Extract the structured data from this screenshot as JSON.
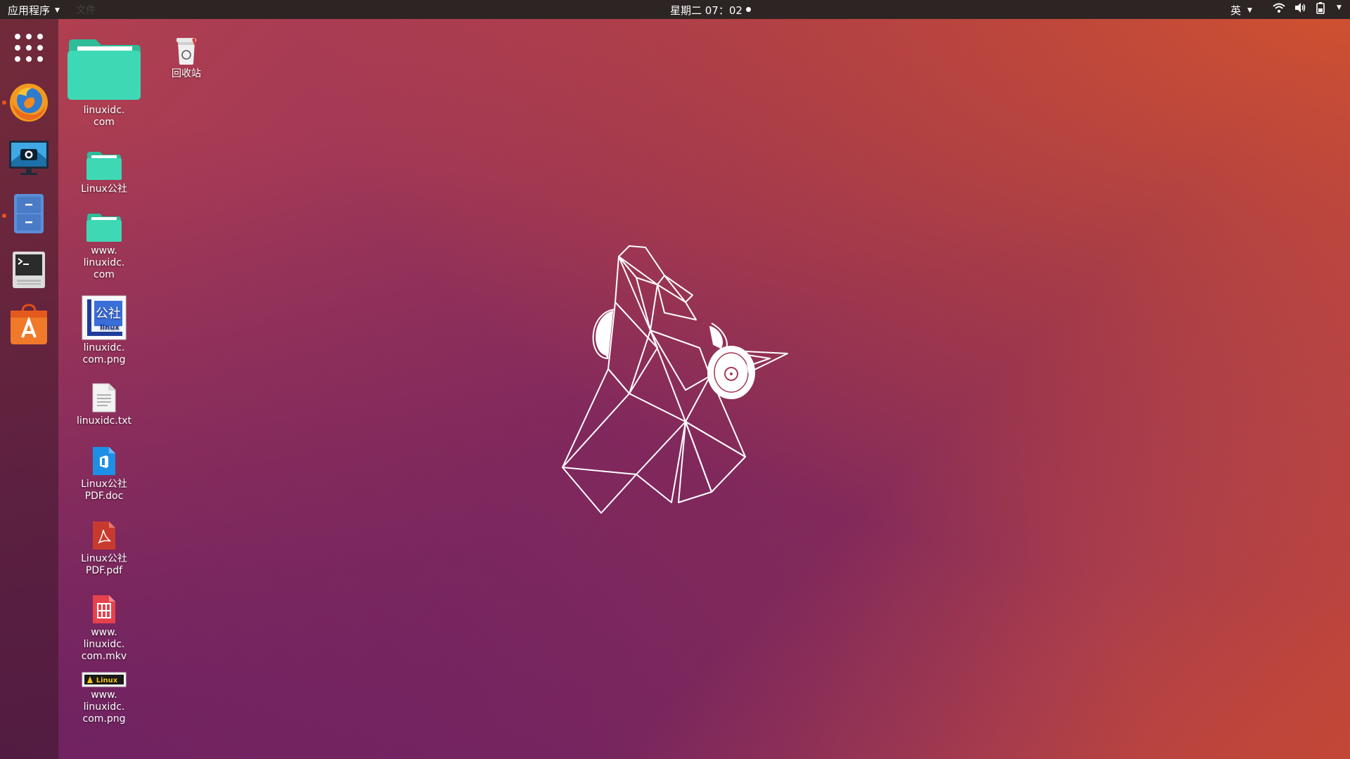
{
  "topbar": {
    "apps_label": "应用程序",
    "ghost_label": "文件",
    "clock": "星期二 07：02",
    "ime": "英"
  },
  "dock": {
    "items": [
      {
        "name": "show-applications",
        "icon": "grid-icon",
        "running": false
      },
      {
        "name": "firefox",
        "icon": "firefox-icon",
        "running": true
      },
      {
        "name": "screenshot",
        "icon": "screenshot-icon",
        "running": false
      },
      {
        "name": "files",
        "icon": "file-cabinet-icon",
        "running": true
      },
      {
        "name": "terminal",
        "icon": "terminal-icon",
        "running": false
      },
      {
        "name": "software",
        "icon": "software-store-icon",
        "running": false
      }
    ]
  },
  "desktop": {
    "icons": [
      {
        "label": "linuxidc.\ncom",
        "type": "folder-large"
      },
      {
        "label": "回收站",
        "type": "trash"
      },
      {
        "label": "Linux公社",
        "type": "folder"
      },
      {
        "label": "www.\nlinuxidc.\ncom",
        "type": "folder"
      },
      {
        "label": "linuxidc.\ncom.png",
        "type": "image-logo",
        "thumb_text_1": "公社",
        "thumb_text_2": "linux"
      },
      {
        "label": "linuxidc.txt",
        "type": "text-file"
      },
      {
        "label": "Linux公社\nPDF.doc",
        "type": "doc-file"
      },
      {
        "label": "Linux公社\nPDF.pdf",
        "type": "pdf-file"
      },
      {
        "label": "www.\nlinuxidc.\ncom.mkv",
        "type": "video-file"
      },
      {
        "label": "www.\nlinuxidc.\ncom.png",
        "type": "image-banner",
        "thumb_text": "Linux"
      }
    ]
  },
  "colors": {
    "accent": "#e95420",
    "folder": "#3fd8b5",
    "topbar": "#2c2524"
  }
}
